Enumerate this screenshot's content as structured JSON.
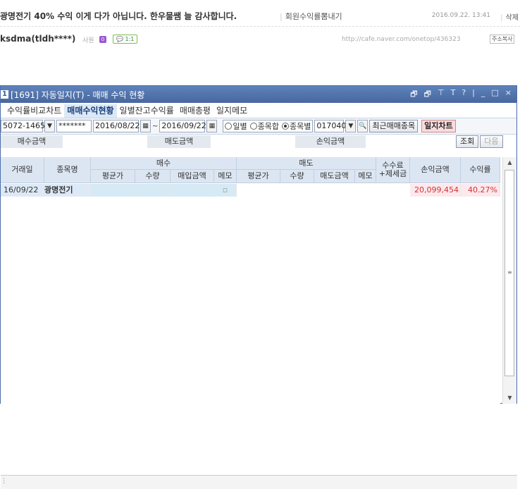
{
  "post": {
    "title": "광명전기 40% 수익 이게 다가 아닙니다. 한우물쌤 늘 감사합니다.",
    "category": "회원수익률뽐내기",
    "date": "2016.09.22. 13:41",
    "delete_label": "삭제",
    "author": "ksdma(tldh****)",
    "level": "사원",
    "level_badge": "0",
    "chat_label": "1:1",
    "url": "http://cafe.naver.com/onetop/436323",
    "copy_label": "주소복사"
  },
  "window": {
    "num": "1",
    "title": "[1691] 자동일지(T) - 매매 수익 현황",
    "controls": [
      "🗗",
      "🗗",
      "⊤",
      "T",
      "?",
      "|",
      "_",
      "□",
      "×"
    ]
  },
  "tabs": [
    "수익률비교차트",
    "매매수익현황",
    "일별잔고수익률",
    "매매총평",
    "일지메모"
  ],
  "toolbar": {
    "account": "5072-1465",
    "password": "*******",
    "date_from": "2016/08/22",
    "date_to": "2016/09/22",
    "radio_daily": "일별",
    "radio_total": "종목합",
    "radio_by_item": "종목별",
    "code": "017040",
    "recent_button": "최근매매종목",
    "chart_button": "일지차트"
  },
  "summary": {
    "buy_label": "매수금액",
    "sell_label": "매도금액",
    "pl_label": "손익금액",
    "query_button": "조회",
    "next_button": "다음"
  },
  "table": {
    "date": "거래일",
    "name": "종목명",
    "buy": "매수",
    "sell": "매도",
    "buy_avg": "평균가",
    "buy_qty": "수량",
    "buy_amount": "매입금액",
    "buy_memo": "메모",
    "sell_avg": "평균가",
    "sell_qty": "수량",
    "sell_amount": "매도금액",
    "sell_memo": "메모",
    "fee": "수수료\n+제세금",
    "pl": "손익금액",
    "rate": "수익률"
  },
  "rows": [
    {
      "date": "16/09/22",
      "name": "광명전기",
      "pl": "20,099,454",
      "rate": "40.27%"
    }
  ],
  "colors": {
    "title_bar": "#5e82bb",
    "header_bg": "#dce6f2",
    "profit": "#d33333"
  }
}
